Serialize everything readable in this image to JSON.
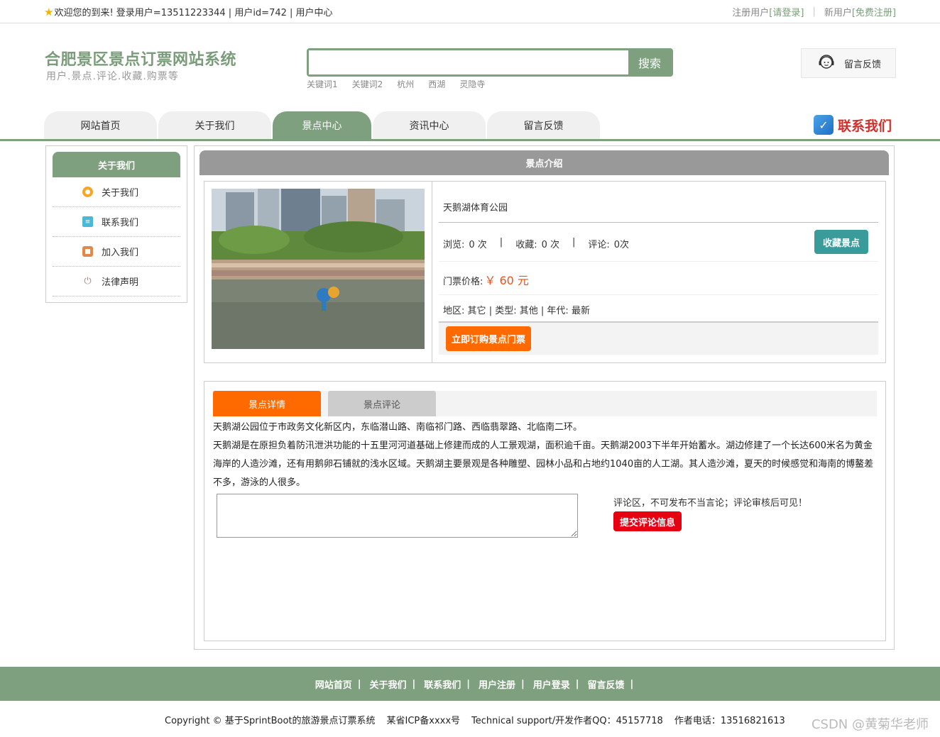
{
  "topbar": {
    "welcome": "欢迎您的到来! 登录用户=13511223344 | 用户id=742 | 用户中心",
    "registered_label": "注册用户",
    "login_link": "[请登录]",
    "new_user_label": "新用户",
    "register_link": "[免费注册]"
  },
  "header": {
    "title": "合肥景区景点订票网站系统",
    "subtitle": "用户.景点.评论.收藏.购票等",
    "search_button": "搜索",
    "search_value": "",
    "keywords": [
      "关键词1",
      "关键词2",
      "杭州",
      "西湖",
      "灵隐寺"
    ],
    "feedback_button": "留言反馈"
  },
  "nav": {
    "items": [
      "网站首页",
      "关于我们",
      "景点中心",
      "资讯中心",
      "留言反馈"
    ],
    "active_index": 2,
    "contact": "联系我们"
  },
  "sidebar": {
    "title": "关于我们",
    "items": [
      {
        "label": "关于我们",
        "icon": "circle-icon",
        "color": "#f5a623"
      },
      {
        "label": "联系我们",
        "icon": "clipboard-icon",
        "color": "#4ab8d8"
      },
      {
        "label": "加入我们",
        "icon": "lock-icon",
        "color": "#e08a4a"
      },
      {
        "label": "法律声明",
        "icon": "power-icon",
        "color": "#c0787a"
      }
    ]
  },
  "main": {
    "title": "景点介绍",
    "spot": {
      "name": "天鹅湖体育公园",
      "views_label": "浏览:",
      "views": "0 次",
      "favs_label": "收藏:",
      "favs": "0 次",
      "comments_label": "评论:",
      "comments": "0次",
      "fav_button": "收藏景点",
      "price_label": "门票价格:",
      "price": "￥ 60 元",
      "region_label": "地区:",
      "region": "其它",
      "type_label": "类型:",
      "type": "其他",
      "era_label": "年代:",
      "era": "最新",
      "buy_button": "立即订购景点门票"
    },
    "tabs": [
      "景点详情",
      "景点评论"
    ],
    "description": [
      "天鹅湖公园位于市政务文化新区内，东临潜山路、南临祁门路、西临翡翠路、北临南二环。",
      "天鹅湖是在原担负着防汛泄洪功能的十五里河河道基础上修建而成的人工景观湖，面积逾千亩。天鹅湖2003下半年开始蓄水。湖边修建了一个长达600米名为黄金海岸的人造沙滩，还有用鹅卵石铺就的浅水区域。天鹅湖主要景观是各种雕塑、园林小品和占地约1040亩的人工湖。其人造沙滩，夏天的时候感觉和海南的博鳌差不多，游泳的人很多。"
    ],
    "comment_note": "评论区，不可发布不当言论；评论审核后可见！",
    "submit_button": "提交评论信息"
  },
  "footer": {
    "links": [
      "网站首页",
      "关于我们",
      "联系我们",
      "用户注册",
      "用户登录",
      "留言反馈"
    ],
    "copyright": "Copyright © 基于SprintBoot的旅游景点订票系统",
    "icp": "某省ICP备xxxx号",
    "support": "Technical support/开发作者QQ：45157718",
    "phone": "作者电话：13516821613"
  },
  "watermark": "CSDN @黄菊华老师",
  "colors": {
    "brand": "#7fa07f",
    "orange": "#ff6a00",
    "teal": "#3a9b9b",
    "red": "#e60012"
  }
}
